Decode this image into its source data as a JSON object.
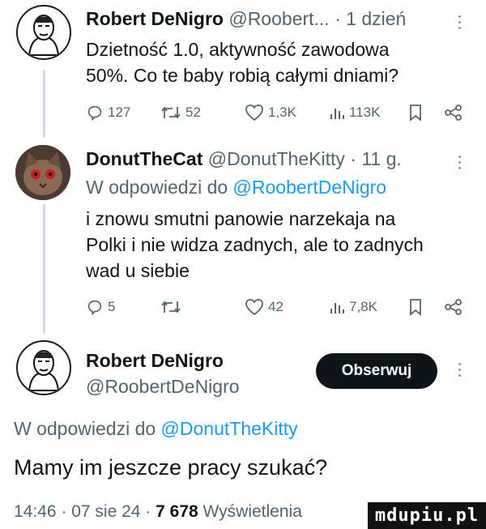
{
  "tweet1": {
    "author": "Robert DeNigro",
    "handle": "@Roobert...",
    "sep": "·",
    "time": "1 dzień",
    "text_line1": "Dzietność 1.0, aktywność zawodowa",
    "text_line2": "50%. Co te baby robią całymi dniami?",
    "stats": {
      "replies": "127",
      "reposts": "52",
      "likes": "1,3K",
      "views": "113K"
    }
  },
  "tweet2": {
    "author": "DonutTheCat",
    "handle": "@DonutTheKitty",
    "sep": "·",
    "time": "11 g.",
    "reply_prefix": "W odpowiedzi do",
    "reply_to": "@RoobertDeNigro",
    "text_line1": "i znowu smutni panowie narzekaja na",
    "text_line2": "Polki i nie widza zadnych, ale to zadnych",
    "text_line3": "wad u siebie",
    "stats": {
      "replies": "5",
      "reposts": "",
      "likes": "42",
      "views": "7,8K"
    }
  },
  "tweet3": {
    "author": "Robert DeNigro",
    "handle": "@RoobertDeNigro",
    "follow_label": "Obserwuj",
    "reply_prefix": "W odpowiedzi do",
    "reply_to": "@DonutTheKitty",
    "text": "Mamy im jeszcze pracy szukać?",
    "time": "14:46 · 07 sie 24 ·",
    "views_count": "7 678",
    "views_label": "Wyświetlenia"
  },
  "watermark": "mdupiu.pl",
  "icons": [
    "reply-icon",
    "repost-icon",
    "like-icon",
    "views-icon",
    "bookmark-icon",
    "share-icon",
    "more-icon"
  ],
  "colors": {
    "link": "#1d9bf0",
    "muted": "#536471",
    "text": "#0f1419",
    "button": "#0f1419"
  }
}
